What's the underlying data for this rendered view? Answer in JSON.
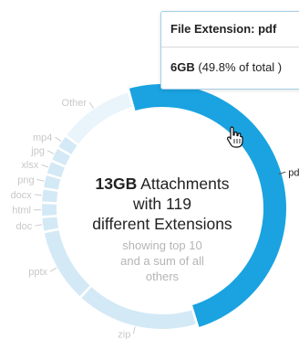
{
  "chart_data": {
    "type": "pie",
    "style": "donut",
    "total_label": "13GB",
    "highlighted": "pdf",
    "slices": [
      {
        "label": "pdf",
        "value": 49.8,
        "color": "#1aa3e0"
      },
      {
        "label": "zip",
        "value": 16.5,
        "color": "#d4e9f6"
      },
      {
        "label": "pptx",
        "value": 10.0,
        "color": "#d4e9f6"
      },
      {
        "label": "doc",
        "value": 2.0,
        "color": "#d4e9f6"
      },
      {
        "label": "html",
        "value": 1.9,
        "color": "#d4e9f6"
      },
      {
        "label": "docx",
        "value": 1.9,
        "color": "#d4e9f6"
      },
      {
        "label": "png",
        "value": 1.9,
        "color": "#d4e9f6"
      },
      {
        "label": "xlsx",
        "value": 1.9,
        "color": "#d4e9f6"
      },
      {
        "label": "jpg",
        "value": 1.9,
        "color": "#d4e9f6"
      },
      {
        "label": "mp4",
        "value": 1.9,
        "color": "#d4e9f6"
      },
      {
        "label": "Other",
        "value": 10.3,
        "color": "#eaf4fb"
      }
    ]
  },
  "center": {
    "size": "13GB",
    "line1_rest": "Attachments",
    "line2": "with 119",
    "line3": "different Extensions",
    "sub1": "showing top 10",
    "sub2": "and a sum of all",
    "sub3": "others"
  },
  "tooltip": {
    "title": "File Extension: pdf",
    "value": "6GB",
    "percent": "(49.8% of total )"
  }
}
